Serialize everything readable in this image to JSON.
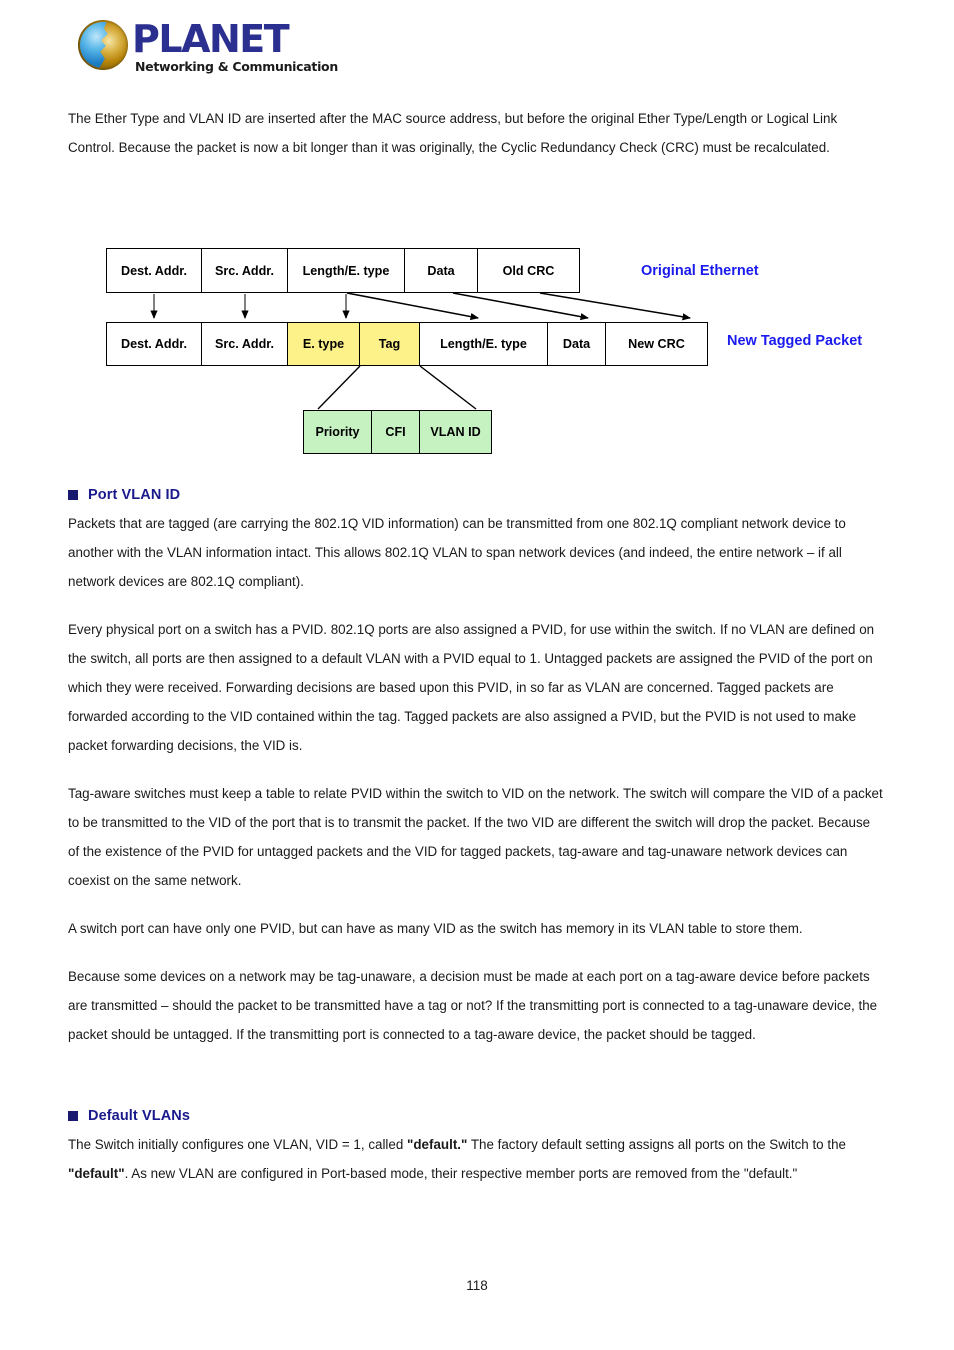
{
  "header": {
    "brand": "PLANET",
    "tagline": "Networking & Communication",
    "logo_icon": "planet-globe-logo"
  },
  "intro_paragraph": "The Ether Type and VLAN ID are inserted after the MAC source address, but before the original Ether Type/Length or Logical Link Control. Because the packet is now a bit longer than it was originally, the Cyclic Redundancy Check (CRC) must be recalculated.",
  "diagram": {
    "original_label": "Original Ethernet",
    "tagged_label": "New Tagged Packet",
    "original_row": [
      {
        "label": "Dest. Addr.",
        "fill": "white"
      },
      {
        "label": "Src. Addr.",
        "fill": "white"
      },
      {
        "label": "Length/E. type",
        "fill": "white"
      },
      {
        "label": "Data",
        "fill": "white"
      },
      {
        "label": "Old CRC",
        "fill": "white"
      }
    ],
    "tagged_row": [
      {
        "label": "Dest. Addr.",
        "fill": "white"
      },
      {
        "label": "Src. Addr.",
        "fill": "white"
      },
      {
        "label": "E. type",
        "fill": "yellow"
      },
      {
        "label": "Tag",
        "fill": "yellow"
      },
      {
        "label": "Length/E. type",
        "fill": "white"
      },
      {
        "label": "Data",
        "fill": "white"
      },
      {
        "label": "New CRC",
        "fill": "white"
      }
    ],
    "tag_detail_row": [
      {
        "label": "Priority",
        "fill": "green"
      },
      {
        "label": "CFI",
        "fill": "green"
      },
      {
        "label": "VLAN ID",
        "fill": "green"
      }
    ],
    "colors": {
      "label_blue": "#1a1aee",
      "tag_yellow": "#fdf189",
      "detail_green": "#c5f2c0",
      "border": "#000000"
    }
  },
  "sections": [
    {
      "heading": "Port VLAN ID",
      "paragraphs": [
        "Packets that are tagged (are carrying the 802.1Q VID information) can be transmitted from one 802.1Q compliant network device to another with the VLAN information intact. This allows 802.1Q VLAN to span network devices (and indeed, the entire network – if all network devices are 802.1Q compliant).",
        "Every physical port on a switch has a PVID. 802.1Q ports are also assigned a PVID, for use within the switch. If no VLAN are defined on the switch, all ports are then assigned to a default VLAN with a PVID equal to 1. Untagged packets are assigned the PVID of the port on which they were received. Forwarding decisions are based upon this PVID, in so far as VLAN are concerned. Tagged packets are forwarded according to the VID contained within the tag. Tagged packets are also assigned a PVID, but the PVID is not used to make packet forwarding decisions, the VID is.",
        "Tag-aware switches must keep a table to relate PVID within the switch to VID on the network. The switch will compare the VID of a packet to be transmitted to the VID of the port that is to transmit the packet. If the two VID are different the switch will drop the packet. Because of the existence of the PVID for untagged packets and the VID for tagged packets, tag-aware and tag-unaware network devices can coexist on the same network.",
        "A switch port can have only one PVID, but can have as many VID as the switch has memory in its VLAN table to store them.",
        "Because some devices on a network may be tag-unaware, a decision must be made at each port on a tag-aware device before packets are transmitted – should the packet to be transmitted have a tag or not? If the transmitting port is connected to a tag-unaware device, the packet should be untagged. If the transmitting port is connected to a tag-aware device, the packet should be tagged."
      ]
    },
    {
      "heading": "Default VLANs",
      "default_vlan_paragraph": {
        "part1": "The Switch initially configures one VLAN, VID = 1, called ",
        "bold1": "\"default.\"",
        "part2": " The factory default setting assigns all ports on the Switch to the ",
        "bold2": "\"default\"",
        "part3": ". As new VLAN are configured in Port-based mode, their respective member ports are removed from the \"default.\""
      }
    }
  ],
  "footer": {
    "page_number": "118"
  }
}
